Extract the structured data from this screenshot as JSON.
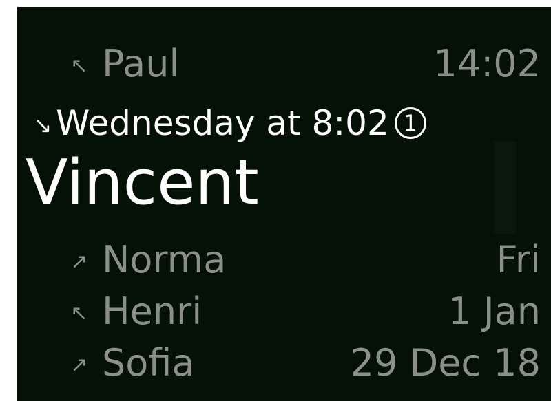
{
  "calls": [
    {
      "arrow": "↖",
      "arrow_icon": "incoming-call-icon",
      "name": "Paul",
      "time": "14:02"
    },
    {
      "arrow": "↗",
      "arrow_icon": "outgoing-call-icon",
      "name": "Norma",
      "time": "Fri"
    },
    {
      "arrow": "↖",
      "arrow_icon": "incoming-call-icon",
      "name": "Henri",
      "time": "1 Jan"
    },
    {
      "arrow": "↗",
      "arrow_icon": "outgoing-call-icon",
      "name": "Sofia",
      "time": "29 Dec 18"
    }
  ],
  "selected": {
    "arrow": "↘",
    "arrow_icon": "missed-call-icon",
    "detail": "Wednesday at 8:02",
    "count": "1",
    "name": "Vincent"
  },
  "colors": {
    "background": "#051007",
    "text_dim": "#8a8f89",
    "text_selected": "#ffffff"
  }
}
